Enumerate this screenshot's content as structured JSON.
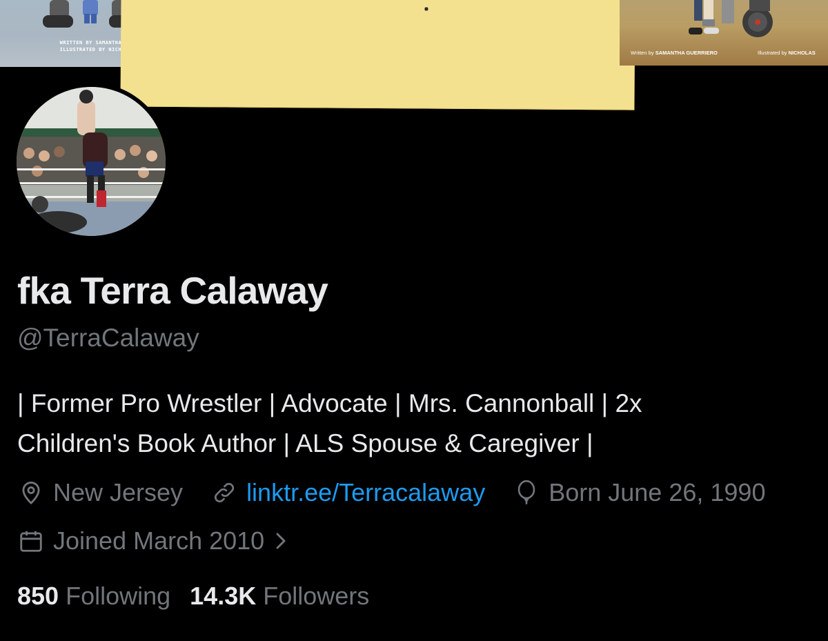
{
  "banner": {
    "left_book": {
      "written_by": "WRITTEN BY SAMANTHA GUERRIERO",
      "illustrated_by": "ILLUSTRATED BY NICHOLAS CAMIA"
    },
    "right_book": {
      "written_prefix": "Written by",
      "writer": "SAMANTHA GUERRIERO",
      "illustrated_prefix": "Illustrated by",
      "illustrator": "NICHOLAS"
    }
  },
  "profile": {
    "display_name": "fka Terra Calaway",
    "handle": "@TerraCalaway",
    "bio_line_1": "| Former Pro Wrestler | Advocate | Mrs. Cannonball | 2x",
    "bio_line_2": "Children's Book Author | ALS Spouse & Caregiver |",
    "location": "New Jersey",
    "location_icon": "map-pin-icon",
    "website": "linktr.ee/Terracalaway",
    "website_icon": "link-icon",
    "birthday": "Born June 26, 1990",
    "birthday_icon": "balloon-icon",
    "joined": "Joined March 2010",
    "joined_icon": "calendar-icon"
  },
  "stats": {
    "following_count": "850",
    "following_label": "Following",
    "followers_count": "14.3K",
    "followers_label": "Followers"
  },
  "colors": {
    "background": "#000000",
    "primary_text": "#e7e9ea",
    "secondary_text": "#71767b",
    "link": "#1d9bf0",
    "sticky_note": "#f4e18f"
  }
}
